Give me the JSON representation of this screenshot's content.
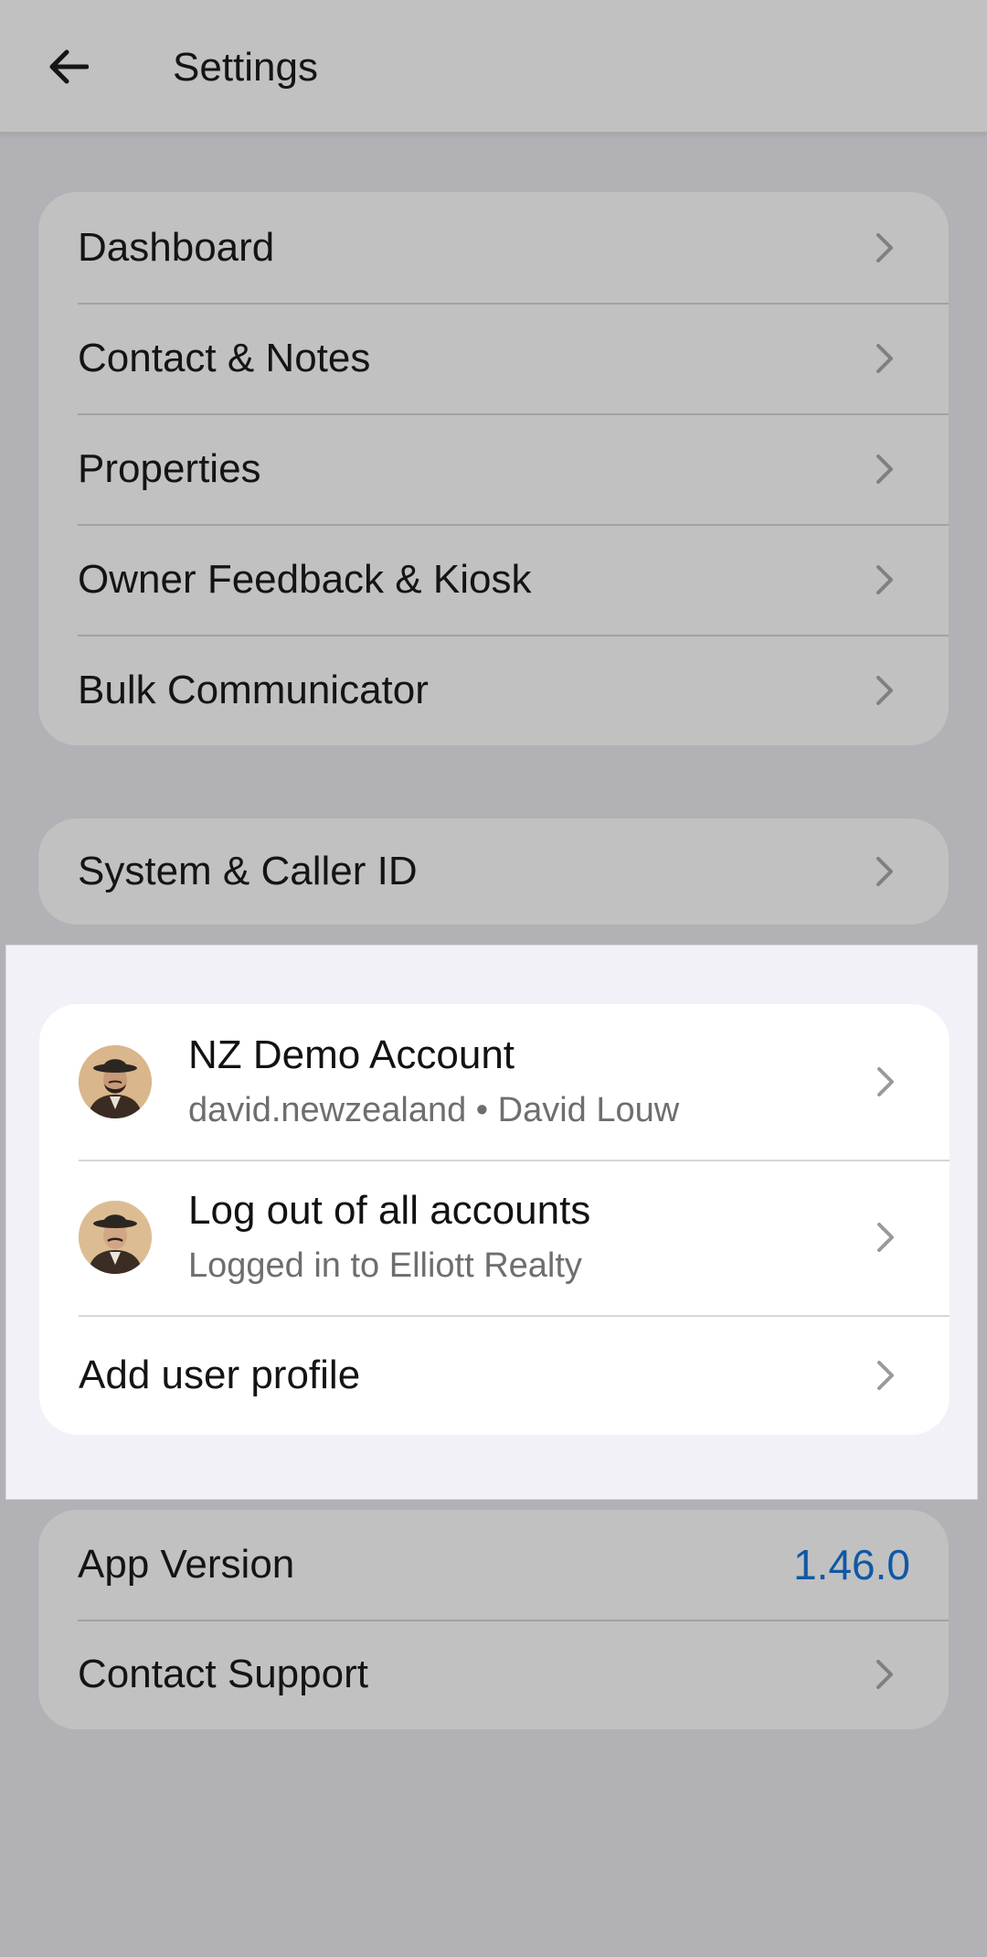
{
  "header": {
    "title": "Settings",
    "back_icon": "arrow-left-icon"
  },
  "nav_group": [
    {
      "label": "Dashboard"
    },
    {
      "label": "Contact & Notes"
    },
    {
      "label": "Properties"
    },
    {
      "label": "Owner Feedback & Kiosk"
    },
    {
      "label": "Bulk Communicator"
    }
  ],
  "system": {
    "label": "System & Caller ID"
  },
  "accounts": {
    "current": {
      "title": "NZ Demo Account",
      "subtitle": "david.newzealand • David Louw"
    },
    "logout": {
      "title": "Log out of all accounts",
      "subtitle": "Logged in to Elliott Realty"
    },
    "add_profile": {
      "label": "Add user profile"
    }
  },
  "about": {
    "app_version_label": "App Version",
    "app_version_value": "1.46.0",
    "support_label": "Contact Support"
  },
  "colors": {
    "accent": "#0f58a6",
    "background": "#b1b1b6",
    "card": "#c1c1c1",
    "overlay": "#f1f1f7"
  }
}
